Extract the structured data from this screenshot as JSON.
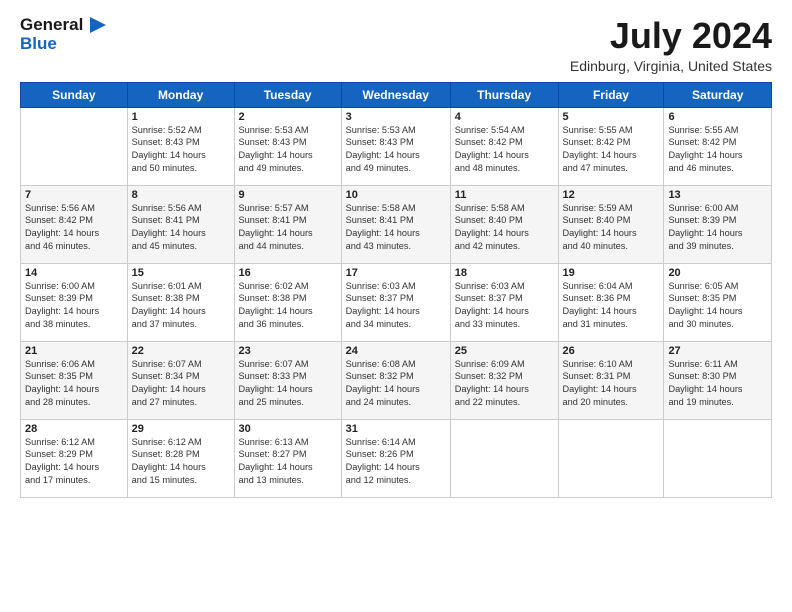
{
  "header": {
    "logo_line1": "General",
    "logo_line2": "Blue",
    "month_year": "July 2024",
    "location": "Edinburg, Virginia, United States"
  },
  "days_of_week": [
    "Sunday",
    "Monday",
    "Tuesday",
    "Wednesday",
    "Thursday",
    "Friday",
    "Saturday"
  ],
  "weeks": [
    [
      {
        "num": "",
        "info": ""
      },
      {
        "num": "1",
        "info": "Sunrise: 5:52 AM\nSunset: 8:43 PM\nDaylight: 14 hours\nand 50 minutes."
      },
      {
        "num": "2",
        "info": "Sunrise: 5:53 AM\nSunset: 8:43 PM\nDaylight: 14 hours\nand 49 minutes."
      },
      {
        "num": "3",
        "info": "Sunrise: 5:53 AM\nSunset: 8:43 PM\nDaylight: 14 hours\nand 49 minutes."
      },
      {
        "num": "4",
        "info": "Sunrise: 5:54 AM\nSunset: 8:42 PM\nDaylight: 14 hours\nand 48 minutes."
      },
      {
        "num": "5",
        "info": "Sunrise: 5:55 AM\nSunset: 8:42 PM\nDaylight: 14 hours\nand 47 minutes."
      },
      {
        "num": "6",
        "info": "Sunrise: 5:55 AM\nSunset: 8:42 PM\nDaylight: 14 hours\nand 46 minutes."
      }
    ],
    [
      {
        "num": "7",
        "info": "Sunrise: 5:56 AM\nSunset: 8:42 PM\nDaylight: 14 hours\nand 46 minutes."
      },
      {
        "num": "8",
        "info": "Sunrise: 5:56 AM\nSunset: 8:41 PM\nDaylight: 14 hours\nand 45 minutes."
      },
      {
        "num": "9",
        "info": "Sunrise: 5:57 AM\nSunset: 8:41 PM\nDaylight: 14 hours\nand 44 minutes."
      },
      {
        "num": "10",
        "info": "Sunrise: 5:58 AM\nSunset: 8:41 PM\nDaylight: 14 hours\nand 43 minutes."
      },
      {
        "num": "11",
        "info": "Sunrise: 5:58 AM\nSunset: 8:40 PM\nDaylight: 14 hours\nand 42 minutes."
      },
      {
        "num": "12",
        "info": "Sunrise: 5:59 AM\nSunset: 8:40 PM\nDaylight: 14 hours\nand 40 minutes."
      },
      {
        "num": "13",
        "info": "Sunrise: 6:00 AM\nSunset: 8:39 PM\nDaylight: 14 hours\nand 39 minutes."
      }
    ],
    [
      {
        "num": "14",
        "info": "Sunrise: 6:00 AM\nSunset: 8:39 PM\nDaylight: 14 hours\nand 38 minutes."
      },
      {
        "num": "15",
        "info": "Sunrise: 6:01 AM\nSunset: 8:38 PM\nDaylight: 14 hours\nand 37 minutes."
      },
      {
        "num": "16",
        "info": "Sunrise: 6:02 AM\nSunset: 8:38 PM\nDaylight: 14 hours\nand 36 minutes."
      },
      {
        "num": "17",
        "info": "Sunrise: 6:03 AM\nSunset: 8:37 PM\nDaylight: 14 hours\nand 34 minutes."
      },
      {
        "num": "18",
        "info": "Sunrise: 6:03 AM\nSunset: 8:37 PM\nDaylight: 14 hours\nand 33 minutes."
      },
      {
        "num": "19",
        "info": "Sunrise: 6:04 AM\nSunset: 8:36 PM\nDaylight: 14 hours\nand 31 minutes."
      },
      {
        "num": "20",
        "info": "Sunrise: 6:05 AM\nSunset: 8:35 PM\nDaylight: 14 hours\nand 30 minutes."
      }
    ],
    [
      {
        "num": "21",
        "info": "Sunrise: 6:06 AM\nSunset: 8:35 PM\nDaylight: 14 hours\nand 28 minutes."
      },
      {
        "num": "22",
        "info": "Sunrise: 6:07 AM\nSunset: 8:34 PM\nDaylight: 14 hours\nand 27 minutes."
      },
      {
        "num": "23",
        "info": "Sunrise: 6:07 AM\nSunset: 8:33 PM\nDaylight: 14 hours\nand 25 minutes."
      },
      {
        "num": "24",
        "info": "Sunrise: 6:08 AM\nSunset: 8:32 PM\nDaylight: 14 hours\nand 24 minutes."
      },
      {
        "num": "25",
        "info": "Sunrise: 6:09 AM\nSunset: 8:32 PM\nDaylight: 14 hours\nand 22 minutes."
      },
      {
        "num": "26",
        "info": "Sunrise: 6:10 AM\nSunset: 8:31 PM\nDaylight: 14 hours\nand 20 minutes."
      },
      {
        "num": "27",
        "info": "Sunrise: 6:11 AM\nSunset: 8:30 PM\nDaylight: 14 hours\nand 19 minutes."
      }
    ],
    [
      {
        "num": "28",
        "info": "Sunrise: 6:12 AM\nSunset: 8:29 PM\nDaylight: 14 hours\nand 17 minutes."
      },
      {
        "num": "29",
        "info": "Sunrise: 6:12 AM\nSunset: 8:28 PM\nDaylight: 14 hours\nand 15 minutes."
      },
      {
        "num": "30",
        "info": "Sunrise: 6:13 AM\nSunset: 8:27 PM\nDaylight: 14 hours\nand 13 minutes."
      },
      {
        "num": "31",
        "info": "Sunrise: 6:14 AM\nSunset: 8:26 PM\nDaylight: 14 hours\nand 12 minutes."
      },
      {
        "num": "",
        "info": ""
      },
      {
        "num": "",
        "info": ""
      },
      {
        "num": "",
        "info": ""
      }
    ]
  ]
}
